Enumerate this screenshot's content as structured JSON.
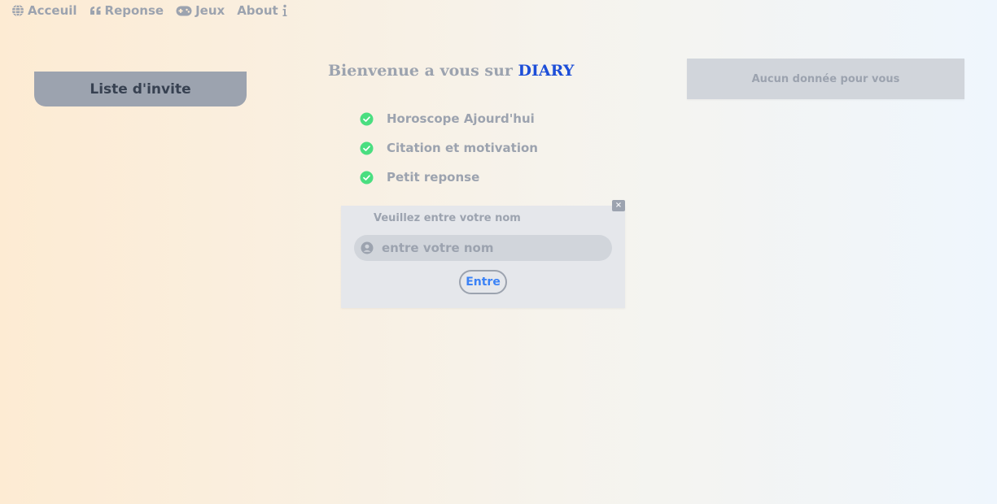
{
  "nav": {
    "items": [
      {
        "label": "Acceuil",
        "icon": "globe-icon"
      },
      {
        "label": "Reponse",
        "icon": "quote-icon"
      },
      {
        "label": "Jeux",
        "icon": "gamepad-icon"
      },
      {
        "label": "About",
        "icon": "info-icon"
      }
    ]
  },
  "invite": {
    "label": "Liste d'invite"
  },
  "welcome": {
    "prefix": "Bienvenue a vous sur ",
    "brand": "DIARY"
  },
  "features": [
    {
      "label": "Horoscope Ajourd'hui",
      "icon": "check-circle-icon"
    },
    {
      "label": "Citation et motivation",
      "icon": "check-circle-icon"
    },
    {
      "label": "Petit reponse",
      "icon": "check-circle-icon"
    }
  ],
  "login": {
    "prompt": "Veuillez entre votre nom",
    "input_placeholder": "entre votre nom",
    "input_value": "",
    "submit_label": "Entre",
    "close_label": "×"
  },
  "right_panel": {
    "message": "Aucun donnée pour vous"
  },
  "colors": {
    "brand": "#1d4ed8",
    "check": "#4ade80",
    "button_text": "#3b82f6",
    "muted": "#9ca3af"
  }
}
